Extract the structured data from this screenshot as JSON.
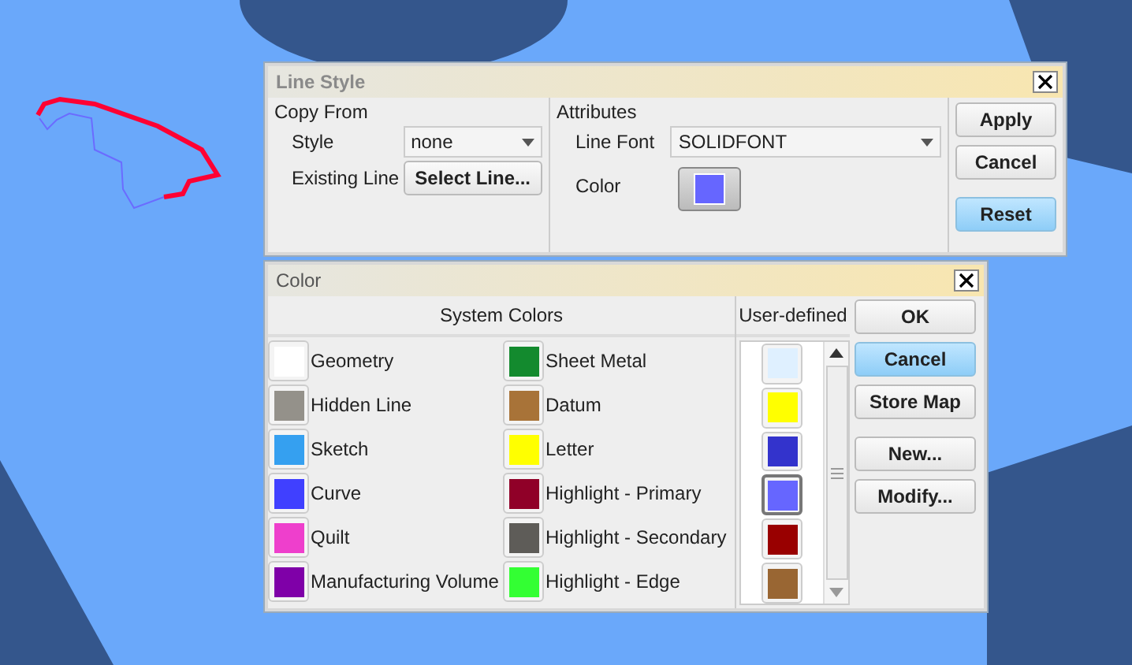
{
  "line_style_dialog": {
    "title": "Line Style",
    "active": false,
    "copy_from": {
      "heading": "Copy From",
      "style_label": "Style",
      "style_value": "none",
      "existing_line_label": "Existing Line",
      "select_button": "Select Line..."
    },
    "attributes": {
      "heading": "Attributes",
      "line_font_label": "Line Font",
      "line_font_value": "SOLIDFONT",
      "color_label": "Color",
      "color": "#6666ff"
    },
    "buttons": [
      {
        "label": "Apply",
        "highlighted": false
      },
      {
        "label": "Cancel",
        "highlighted": false
      },
      {
        "label": "Reset",
        "highlighted": true
      }
    ]
  },
  "color_dialog": {
    "title": "Color",
    "active": true,
    "system_colors_heading": "System Colors",
    "user_defined_heading": "User-defined",
    "system_colors": [
      {
        "name": "Geometry",
        "color": "#ffffff"
      },
      {
        "name": "Hidden Line",
        "color": "#94918a"
      },
      {
        "name": "Sketch",
        "color": "#35a0f0"
      },
      {
        "name": "Curve",
        "color": "#4040ff"
      },
      {
        "name": "Quilt",
        "color": "#ee3fcc"
      },
      {
        "name": "Manufacturing Volume",
        "color": "#7f00a8"
      },
      {
        "name": "Sheet Metal",
        "color": "#138a2e"
      },
      {
        "name": "Datum",
        "color": "#a87338"
      },
      {
        "name": "Letter",
        "color": "#ffff00"
      },
      {
        "name": "Highlight - Primary",
        "color": "#900028"
      },
      {
        "name": "Highlight - Secondary",
        "color": "#5e5c58"
      },
      {
        "name": "Highlight - Edge",
        "color": "#33ff33"
      }
    ],
    "user_colors": [
      {
        "color": "#dff0ff",
        "selected": false
      },
      {
        "color": "#ffff00",
        "selected": false
      },
      {
        "color": "#3333cc",
        "selected": false
      },
      {
        "color": "#6666ff",
        "selected": true
      },
      {
        "color": "#990000",
        "selected": false
      },
      {
        "color": "#996633",
        "selected": false
      }
    ],
    "buttons": [
      {
        "label": "OK",
        "highlighted": false
      },
      {
        "label": "Cancel",
        "highlighted": true
      },
      {
        "label": "Store Map",
        "highlighted": false
      },
      {
        "label": "New...",
        "highlighted": false
      },
      {
        "label": "Modify...",
        "highlighted": false
      }
    ]
  }
}
